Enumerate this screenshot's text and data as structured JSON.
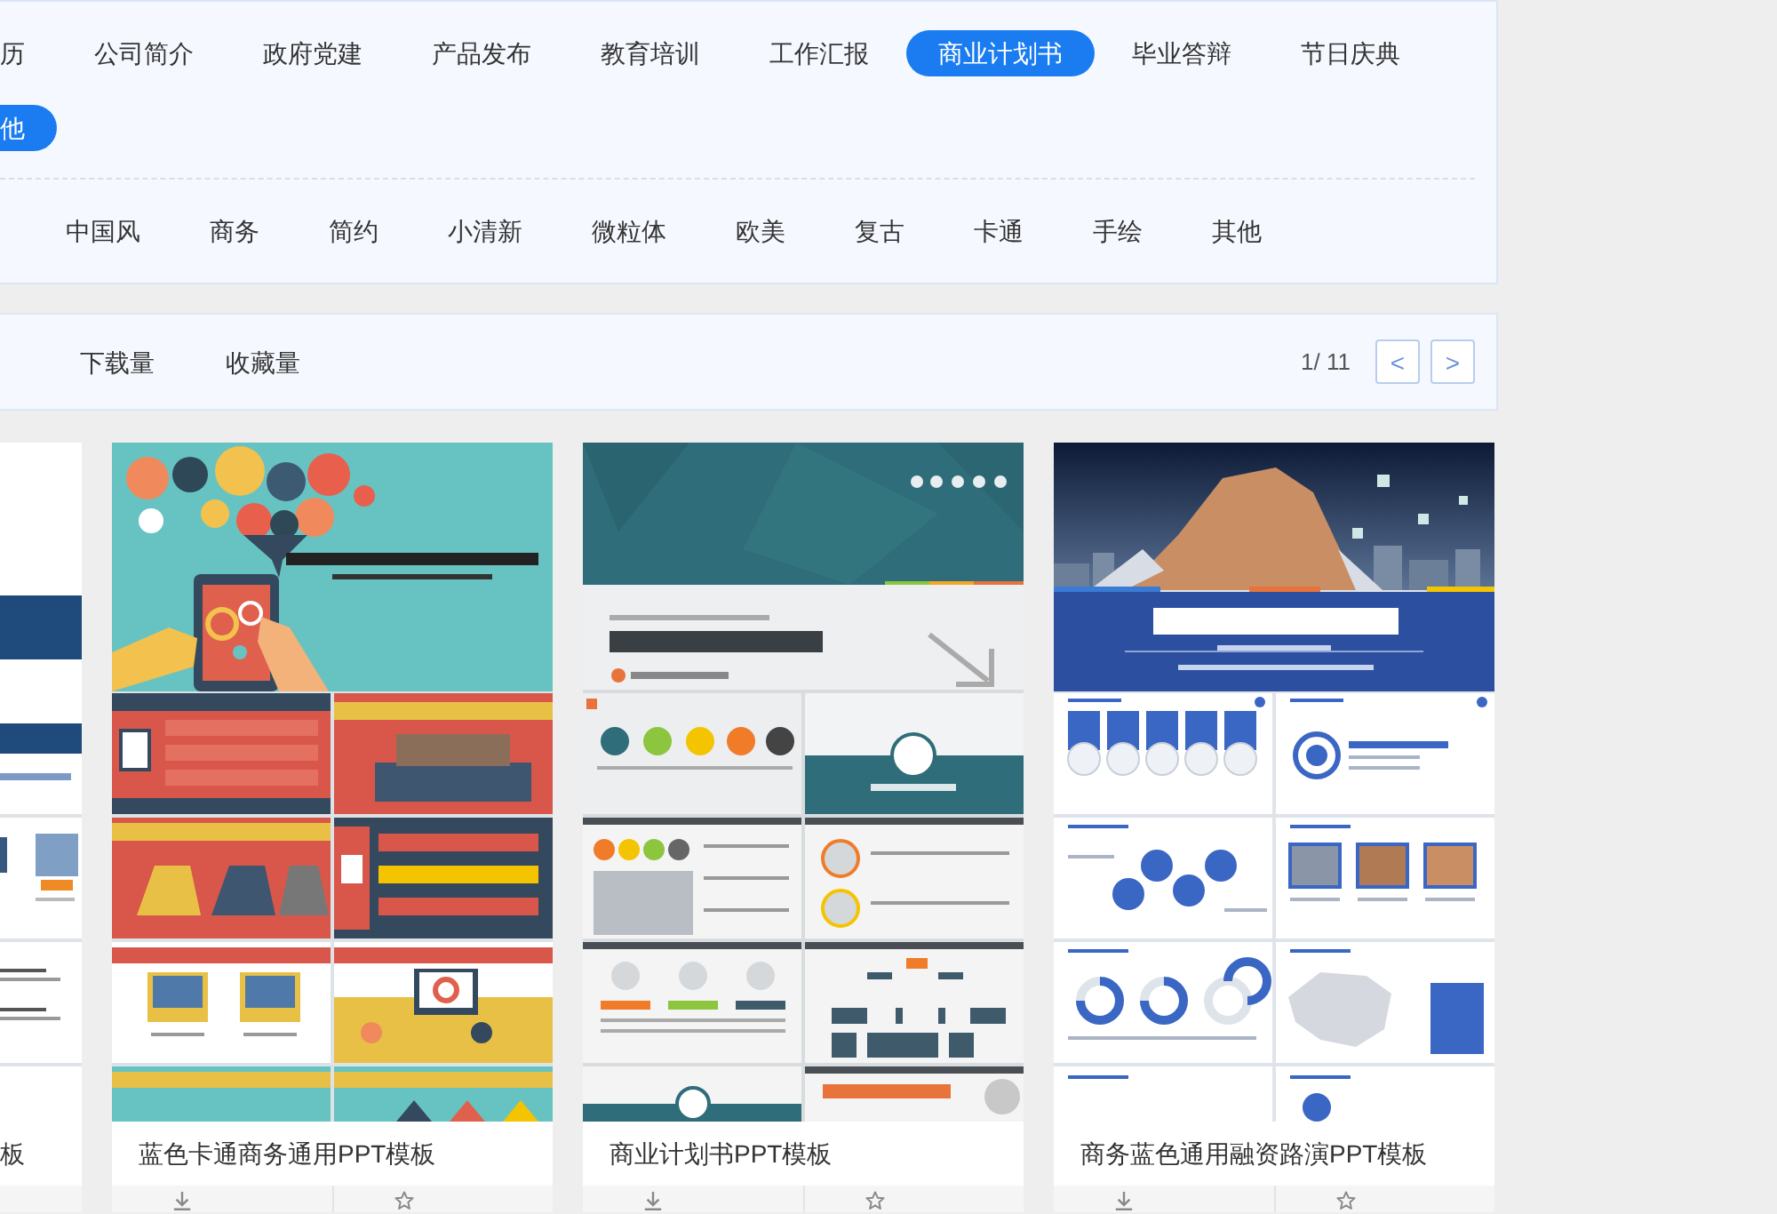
{
  "categories": [
    {
      "label": "历",
      "selected": false
    },
    {
      "label": "公司简介",
      "selected": false
    },
    {
      "label": "政府党建",
      "selected": false
    },
    {
      "label": "产品发布",
      "selected": false
    },
    {
      "label": "教育培训",
      "selected": false
    },
    {
      "label": "工作汇报",
      "selected": false
    },
    {
      "label": "商业计划书",
      "selected": true
    },
    {
      "label": "毕业答辩",
      "selected": false
    },
    {
      "label": "节日庆典",
      "selected": false
    },
    {
      "label": "他",
      "selected": true
    }
  ],
  "styles": [
    {
      "label": "中国风",
      "selected": false
    },
    {
      "label": "商务",
      "selected": false
    },
    {
      "label": "简约",
      "selected": false
    },
    {
      "label": "小清新",
      "selected": false
    },
    {
      "label": "微粒体",
      "selected": false
    },
    {
      "label": "欧美",
      "selected": false
    },
    {
      "label": "复古",
      "selected": false
    },
    {
      "label": "卡通",
      "selected": false
    },
    {
      "label": "手绘",
      "selected": false
    },
    {
      "label": "其他",
      "selected": false
    }
  ],
  "sort": {
    "options": [
      {
        "label": "下载量",
        "selected": false
      },
      {
        "label": "收藏量",
        "selected": false
      }
    ],
    "page": "1/ 11",
    "prev": "<",
    "next": ">"
  },
  "cards": [
    {
      "kind": "cut",
      "title": "板"
    },
    {
      "kind": "full",
      "title": "蓝色卡通商务通用PPT模板"
    },
    {
      "kind": "full",
      "title": "商业计划书PPT模板"
    },
    {
      "kind": "full",
      "title": "商务蓝色通用融资路演PPT模板"
    }
  ]
}
